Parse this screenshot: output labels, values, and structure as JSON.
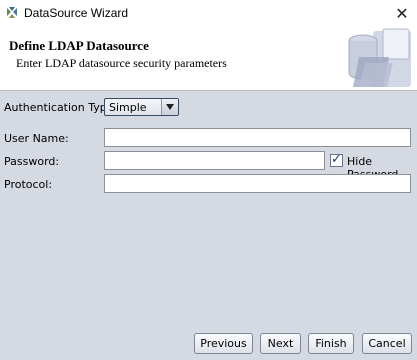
{
  "window": {
    "title": "DataSource Wizard",
    "close_glyph": "✕"
  },
  "header": {
    "title": "Define LDAP Datasource",
    "subtitle": "Enter LDAP datasource security parameters"
  },
  "form": {
    "auth_label": "Authentication Type:",
    "auth_value": "Simple",
    "username_label": "User Name:",
    "username_value": "",
    "password_label": "Password:",
    "password_value": "",
    "hide_password_label": "Hide Password",
    "hide_password_checked": true,
    "protocol_label": "Protocol:",
    "protocol_value": ""
  },
  "buttons": {
    "previous": "Previous",
    "next": "Next",
    "finish": "Finish",
    "cancel": "Cancel"
  },
  "colors": {
    "content_bg": "#d5d9e2",
    "header_bg": "#ffffff"
  }
}
